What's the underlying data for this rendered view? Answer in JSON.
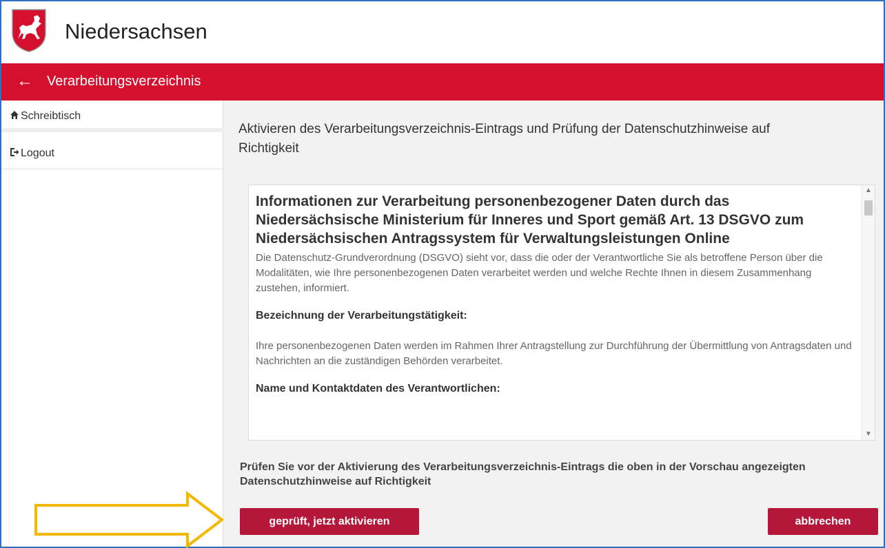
{
  "header": {
    "brand": "Niedersachsen",
    "logo_icon": "niedersachsen-horse-crest"
  },
  "titlebar": {
    "back_icon": "arrow-left-icon",
    "title": "Verarbeitungsverzeichnis",
    "color": "#d5102e"
  },
  "sidebar": {
    "items": [
      {
        "label": "Schreibtisch",
        "icon": "home-icon"
      },
      {
        "label": "Logout",
        "icon": "logout-icon"
      }
    ]
  },
  "main": {
    "title": "Aktivieren des Verarbeitungsverzeichnis-Eintrags und Prüfung der Datenschutzhinweise auf Richtigkeit",
    "preview": {
      "heading": "Informationen zur Verarbeitung personenbezogener Daten durch das Niedersächsische Ministerium für Inneres und Sport gemäß Art. 13 DSGVO zum Niedersächsischen Antragssystem für Verwaltungsleistungen Online",
      "intro": "Die Datenschutz-Grundverordnung (DSGVO) sieht vor, dass die oder der Verantwortliche Sie als betroffene Person über die Modalitäten, wie Ihre personenbezogenen Daten verarbeitet werden und welche Rechte Ihnen in diesem Zusammenhang zustehen, informiert.",
      "section1_title": "Bezeichnung der Verarbeitungstätigkeit:",
      "section1_text": "Ihre personenbezogenen Daten werden im Rahmen Ihrer Antragstellung zur Durchführung der Übermittlung von Antragsdaten und Nachrichten an die zuständigen Behörden verarbeitet.",
      "section2_title": "Name und Kontaktdaten des Verantwortlichen:"
    },
    "hint": "Prüfen Sie vor der Aktivierung des Verarbeitungsverzeichnis-Eintrags die oben in der Vorschau angezeigten Datenschutzhinweise auf Richtigkeit",
    "buttons": {
      "activate": "geprüft, jetzt aktivieren",
      "cancel": "abbrechen",
      "color": "#b5173a"
    }
  },
  "annotation": {
    "arrow_color": "#f5b800"
  }
}
